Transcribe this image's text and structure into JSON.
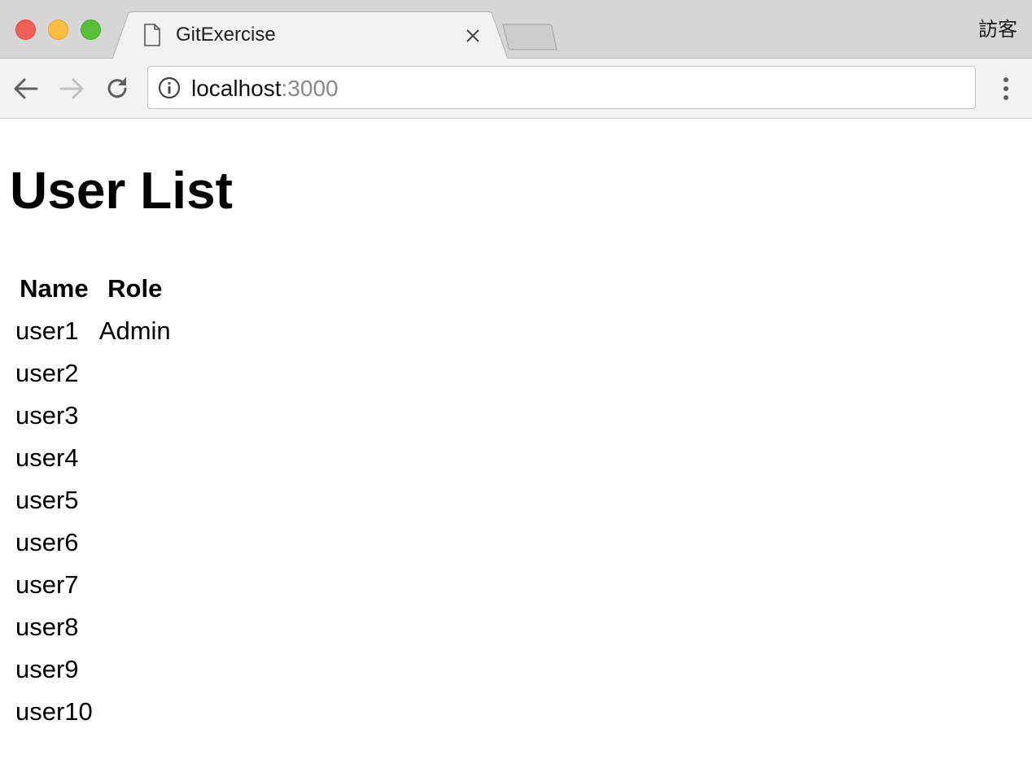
{
  "browser": {
    "tab": {
      "title": "GitExercise",
      "icon": "document-icon"
    },
    "profile_label": "訪客",
    "address": {
      "host": "localhost",
      "port": ":3000"
    }
  },
  "page": {
    "title": "User List",
    "table": {
      "headers": [
        "Name",
        "Role"
      ],
      "rows": [
        {
          "name": "user1",
          "role": "Admin"
        },
        {
          "name": "user2",
          "role": ""
        },
        {
          "name": "user3",
          "role": ""
        },
        {
          "name": "user4",
          "role": ""
        },
        {
          "name": "user5",
          "role": ""
        },
        {
          "name": "user6",
          "role": ""
        },
        {
          "name": "user7",
          "role": ""
        },
        {
          "name": "user8",
          "role": ""
        },
        {
          "name": "user9",
          "role": ""
        },
        {
          "name": "user10",
          "role": ""
        }
      ]
    }
  },
  "colors": {
    "close": "#f25f58",
    "minimize": "#fbbe3e",
    "maximize": "#57c038",
    "port_text": "#8a8a8a"
  }
}
